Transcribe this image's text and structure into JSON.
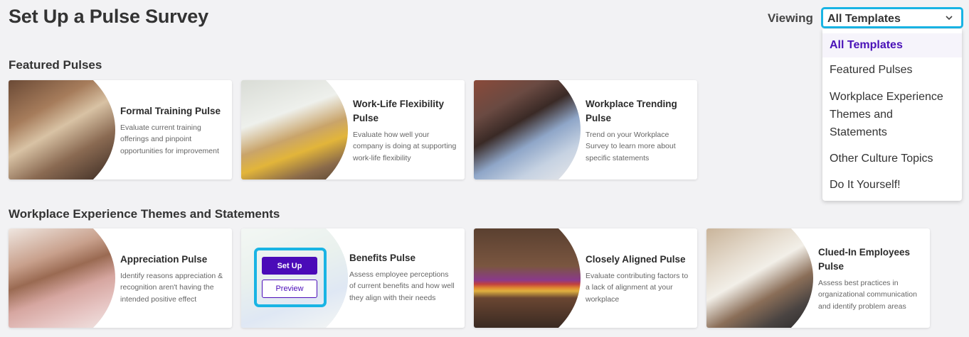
{
  "header": {
    "title": "Set Up a Pulse Survey"
  },
  "filter": {
    "label": "Viewing",
    "selected": "All Templates",
    "options": [
      "All Templates",
      "Featured Pulses",
      "Workplace Experience Themes and Statements",
      "Other Culture Topics",
      "Do It Yourself!"
    ]
  },
  "sections": [
    {
      "title": "Featured Pulses",
      "cards": [
        {
          "title": "Formal Training Pulse",
          "description": "Evaluate current training offerings and pinpoint opportunities for improvement"
        },
        {
          "title": "Work-Life Flexibility Pulse",
          "description": "Evaluate how well your company is doing at supporting work-life flexibility"
        },
        {
          "title": "Workplace Trending Pulse",
          "description": "Trend on your Workplace Survey to learn more about specific statements"
        }
      ]
    },
    {
      "title": "Workplace Experience Themes and Statements",
      "cards": [
        {
          "title": "Appreciation Pulse",
          "description": "Identify reasons appreciation & recognition aren't having the intended positive effect"
        },
        {
          "title": "Benefits Pulse",
          "description": "Assess employee perceptions of current benefits and how well they align with their needs",
          "setup_label": "Set Up",
          "preview_label": "Preview"
        },
        {
          "title": "Closely Aligned Pulse",
          "description": "Evaluate contributing factors to a lack of alignment at your workplace"
        },
        {
          "title": "Clued-In Employees Pulse",
          "description": "Assess best practices in organizational communication and identify problem areas"
        }
      ]
    }
  ],
  "colors": {
    "accent": "#4a0bb8",
    "focus": "#19b4e4",
    "background": "#f2f2f4"
  }
}
